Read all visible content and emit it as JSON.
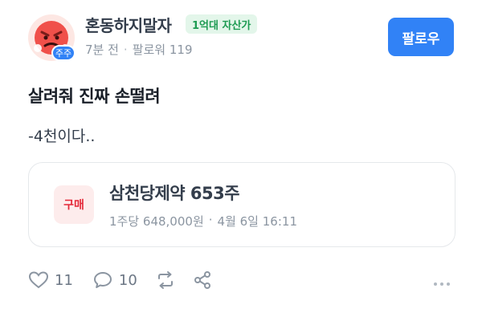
{
  "post": {
    "author": {
      "name": "혼동하지말자",
      "badge": "1억대 자산가",
      "avatar_badge": "주주",
      "avatar_icon": "angry-face-icon"
    },
    "meta": {
      "time": "7분 전",
      "separator": "·",
      "followers": "팔로워 119"
    },
    "follow_label": "팔로우",
    "title": "살려줘 진짜 손떨려",
    "body": "-4천이다..",
    "trade": {
      "type": "구매",
      "title": "삼천당제약 653주",
      "price": "1주당 648,000원",
      "separator": "·",
      "datetime": "4월 6일 16:11"
    },
    "actions": {
      "likes": "11",
      "comments": "10",
      "icons": [
        "heart-icon",
        "comment-icon",
        "repost-icon",
        "share-icon",
        "more-icon"
      ]
    }
  },
  "colors": {
    "accent": "#3182f6",
    "buy": "#e42939",
    "badge_green": "#1d9b52"
  }
}
